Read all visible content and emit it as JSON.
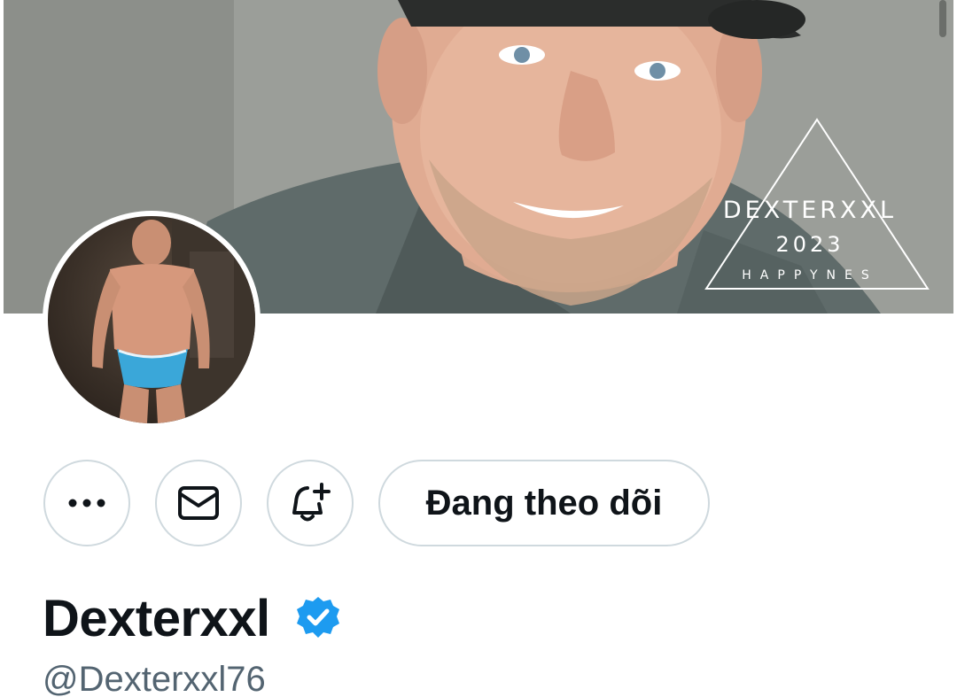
{
  "banner": {
    "watermark_name": "DEXTERXXL",
    "watermark_year": "2023",
    "watermark_sub": "HAPPYNES"
  },
  "actions": {
    "more_icon": "more-horizontal-icon",
    "message_icon": "envelope-icon",
    "notify_icon": "bell-plus-icon",
    "follow_label": "Đang theo dõi"
  },
  "profile": {
    "display_name": "Dexterxxl",
    "handle": "@Dexterxxl76",
    "verified_icon": "verified-badge-icon"
  },
  "colors": {
    "accent": "#1d9bf0",
    "text_primary": "#0f1419",
    "text_secondary": "#536471",
    "border": "#cfd9de"
  }
}
